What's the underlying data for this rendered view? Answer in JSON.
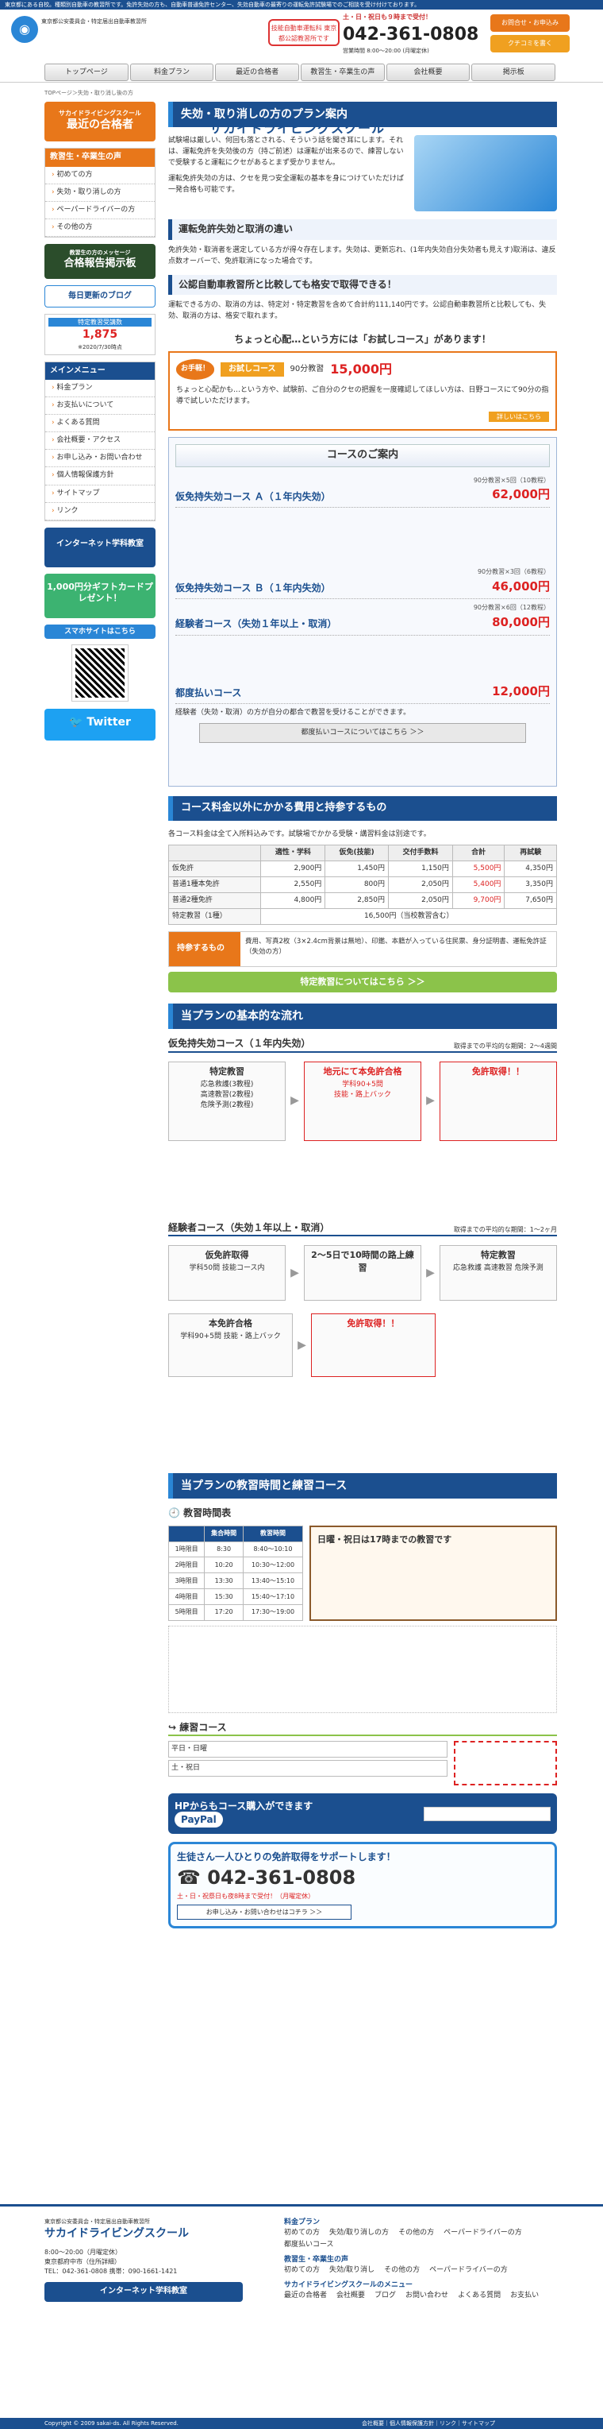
{
  "header": {
    "strip": "東京都にある自校。種類別自動車の教習所です。免許失効の方も、自動車普通免許センター、失効自動車の最寄りの運転免許試験場でのご相談を受け付けております。",
    "logo_sub": "東京都公安委員会・特定届出自動車教習所",
    "logo_main": "サカイドライビングスクール",
    "badge": "技能自動車運転科 東京都公認教習所です",
    "tel_hours": "土・日・祝日も９時まで受付！",
    "tel": "042-361-0808",
    "tel_note": "営業時間 8:00～20:00 (月曜定休)",
    "btn_apply": "お問合せ・お申込み",
    "btn_contact": "クチコミを書く",
    "nav": [
      "トップページ",
      "料金プラン",
      "最近の合格者",
      "教習生・卒業生の声",
      "会社概要",
      "掲示板"
    ]
  },
  "breadcrumb": "TOPページ＞失効・取り消し後の方",
  "sidebar": {
    "promo_title": "サカイドライビングスクール",
    "promo_sub": "最近の合格者",
    "menu1_title": "教習生・卒業生の声",
    "menu1": [
      "初めての方",
      "失効・取り消しの方",
      "ペーパードライバーの方",
      "その他の方"
    ],
    "board_title": "合格報告掲示板",
    "board_sub": "教習生の方のメッセージ",
    "blog": "毎日更新のブログ",
    "counter_label": "特定教習受講数",
    "counter_value": "1,875",
    "counter_note": "※2020/7/30時点",
    "menu2_title": "メインメニュー",
    "menu2": [
      "料金プラン",
      "お支払いについて",
      "よくある質問",
      "会社概要・アクセス",
      "お申し込み・お問い合わせ",
      "個人情報保護方針",
      "サイトマップ",
      "リンク"
    ],
    "net_label": "インターネット学科教室",
    "gift_label": "1,000円分ギフトカードプレゼント！",
    "mobile_label": "スマホサイトはこちら",
    "twitter_label": "Twitter"
  },
  "main": {
    "title": "失効・取り消しの方のプラン案内",
    "intro": "試験場は厳しい、何回も落とされる、そういう話を聞き耳にします。それは、運転免許を失効後の方（持ご前述）は運転が出来るので、練習しないで受験すると運転にクセがあるとまず受かりません。",
    "intro2": "運転免許失効の方は、クセを見つ安全運転の基本を身につけていただけば一発合格も可能です。",
    "h1": "運転免許失効と取消の違い",
    "p1": "免許失効・取消者を選定している方が得々存在します。失効は、更新忘れ、(1年内失効自分失効者も見えす)取消は、違反点数オーバーで、免許取消になった場合です。",
    "h2": "公認自動車教習所と比較しても格安で取得できる！",
    "p2": "運転できる方の、取消の方は、特定対・特定教習を含めて合計約111,140円です。公認自動車教習所と比較しても、失効、取消の方は、格安で取れます。",
    "trial_head": "ちょっと心配…という方には「お試しコース」があります！",
    "trial_tag": "お手軽！",
    "trial_name": "お試しコース",
    "trial_hours": "90分教習",
    "trial_price": "15,000円",
    "trial_desc": "ちょっと心配かも…という方や、試験前、ご自分のクセの把握を一度確認してほしい方は、日野コースにて90分の指導で試しいただけます。",
    "trial_link": "詳しいはこちら",
    "plans_title": "コースのご案内",
    "plan_a_name": "仮免持失効コース Ａ（１年内失効）",
    "plan_a_hours": "90分教習×5回（10教程）",
    "plan_a_price": "62,000円",
    "plan_b_name": "仮免持失効コース Ｂ（１年内失効）",
    "plan_b_hours": "90分教習×3回（6教程）",
    "plan_b_price": "46,000円",
    "plan_c_name": "経験者コース（失効１年以上・取消）",
    "plan_c_hours": "90分教習×6回（12教程）",
    "plan_c_price": "80,000円",
    "plan_d_name": "都度払いコース",
    "plan_d_price": "12,000円",
    "plan_d_note": "経験者（失効・取消）の方が自分の都合で教習を受けることができます。",
    "plan_d_btn": "都度払いコースについてはこちら ＞＞",
    "fees_title": "コース料金以外にかかる費用と持参するもの",
    "fees_note": "各コース料金は全て入所料込みです。試験場でかかる受験・講習料金は別途です。",
    "fees_headers": [
      "",
      "適性・学科",
      "仮免(技能)",
      "交付手数料",
      "合計",
      "再試験"
    ],
    "fees_rows": [
      [
        "仮免許",
        "2,900円",
        "1,450円",
        "1,150円",
        "5,500円",
        "4,350円"
      ],
      [
        "普通1種本免許",
        "2,550円",
        "800円",
        "2,050円",
        "5,400円",
        "3,350円"
      ],
      [
        "普通2種免許",
        "4,800円",
        "2,850円",
        "2,050円",
        "9,700円",
        "7,650円"
      ],
      [
        "特定教習（1種）",
        "",
        "16,500円（当校教習含む）",
        "",
        "",
        ""
      ]
    ],
    "bring_label": "持参するもの",
    "bring_text": "費用、写真2枚（3×2.4cm背景は無地）、印鑑、本籍が入っている住民票、身分証明書、運転免許証（失効の方）",
    "bring_btn": "特定教習についてはこちら ＞＞",
    "flow_title": "当プランの基本的な流れ",
    "flow_a_tag": "仮免持失効コース",
    "flow_a_name": "仮免持失効コース（１年内失効）",
    "flow_a_time": "取得までの平均的な期間：2～4週間",
    "flow_b_name": "経験者コース（失効１年以上・取消）",
    "flow_b_time": "取得までの平均的な期間：1～2ヶ月",
    "sched_title": "当プランの教習時間と練習コース",
    "sched_sub": "教習時間表",
    "sched_headers": [
      "",
      "集合時間",
      "教習時間"
    ],
    "sched_rows": [
      [
        "1時限目",
        "8:30",
        "8:40～10:10"
      ],
      [
        "2時限目",
        "10:20",
        "10:30～12:00"
      ],
      [
        "3時限目",
        "13:30",
        "13:40～15:10"
      ],
      [
        "4時限目",
        "15:30",
        "15:40～17:10"
      ],
      [
        "5時限目",
        "17:20",
        "17:30～19:00"
      ]
    ],
    "sched_note": "日曜・祝日は17時までの教習です",
    "prac_title": "練習コース",
    "prac_rows": [
      "平日・日曜",
      "土・祝日"
    ],
    "pay_label": "HPからもコース購入ができます",
    "pay_brand": "PayPal",
    "tel_banner": "生徒さん一人ひとりの免許取得をサポートします！",
    "tel_banner_num": "042-361-0808",
    "tel_banner_note": "土・日・祝祭日も夜8時まで受付！（月曜定休）",
    "tel_banner_btn": "お申し込み・お問い合わせはコチラ ＞＞"
  },
  "footer": {
    "logo_sub": "東京都公安委員会・特定届出自動車教習所",
    "logo_main": "サカイドライビングスクール",
    "hours": "8:00～20:00（月曜定休）",
    "addr": "東京都府中市（住所詳細）",
    "tel": "TEL：042-361-0808 携帯：090-1661-1421",
    "net_btn": "インターネット学科教室",
    "col_plan": "料金プラン",
    "col_plan_items": [
      "初めての方",
      "失効/取り消しの方",
      "その他の方",
      "ペーパードライバーの方",
      "都度払いコース"
    ],
    "col_voice": "教習生・卒業生の声",
    "col_voice_items": [
      "初めての方",
      "失効/取り消し",
      "その他の方",
      "ペーパードライバーの方"
    ],
    "col_menu": "サカイドライビングスクールのメニュー",
    "col_menu_items": [
      "最近の合格者",
      "会社概要",
      "ブログ",
      "お問い合わせ",
      "よくある質問",
      "お支払い"
    ],
    "copyright": "Copyright © 2009 sakai-ds. All Rights Reserved.",
    "links": "会社概要｜個人情報保護方針｜リンク｜サイトマップ"
  }
}
